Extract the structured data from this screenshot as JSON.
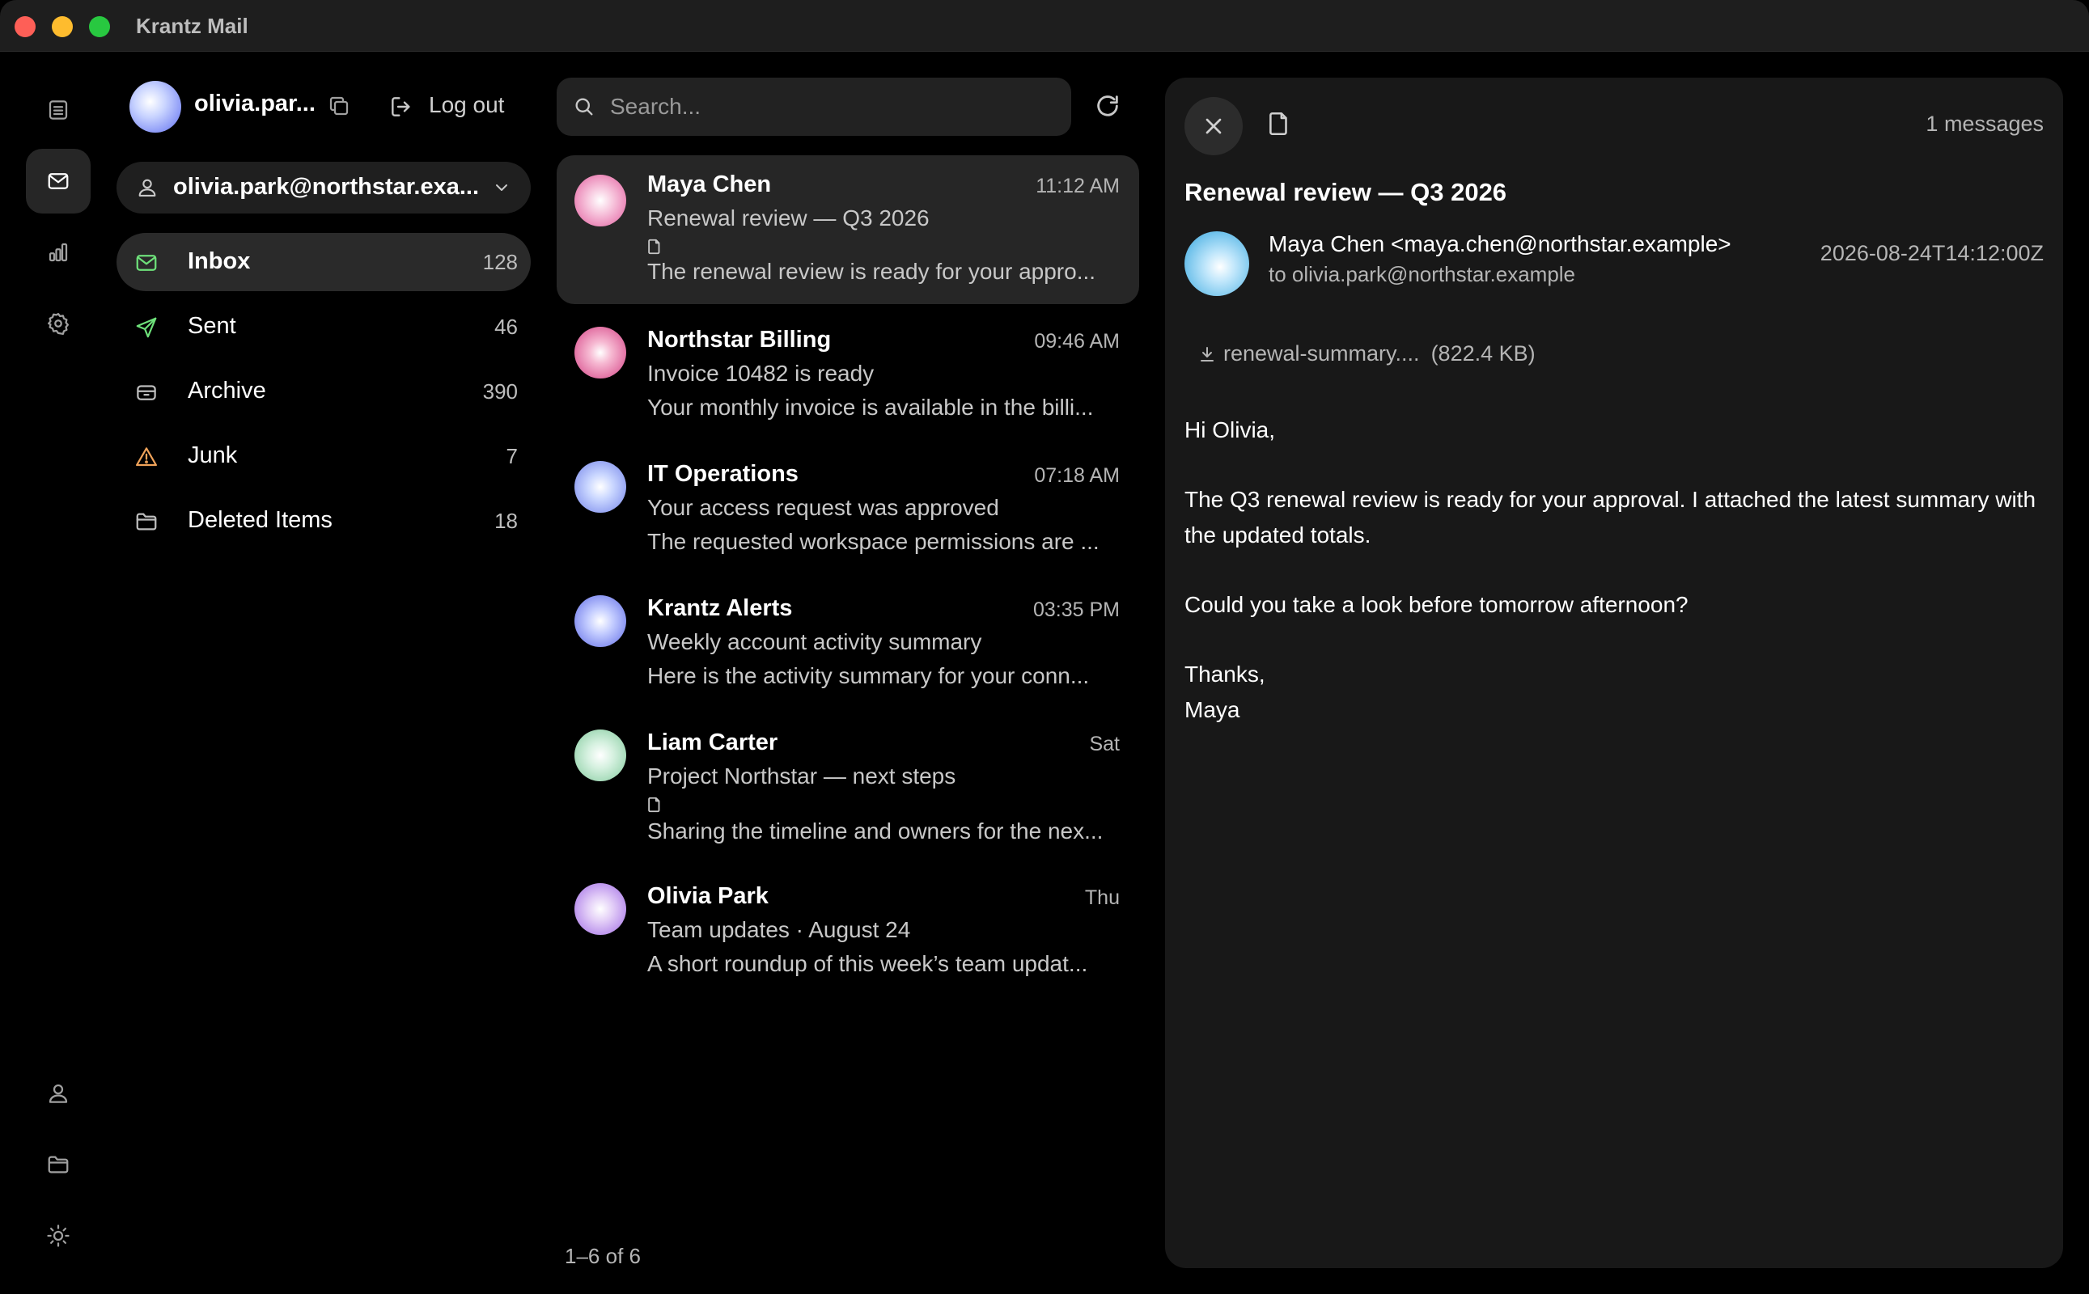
{
  "window": {
    "title": "Krantz Mail"
  },
  "account": {
    "display_name": "olivia.par...",
    "logout_label": "Log out",
    "selected_email": "olivia.park@northstar.exa..."
  },
  "folders": [
    {
      "label": "Inbox",
      "count": "128",
      "icon": "mail-icon",
      "color": "#6ee17a"
    },
    {
      "label": "Sent",
      "count": "46",
      "icon": "send-icon",
      "color": "#6ee17a"
    },
    {
      "label": "Archive",
      "count": "390",
      "icon": "archive-icon",
      "color": "#bdbdbd"
    },
    {
      "label": "Junk",
      "count": "7",
      "icon": "warning-icon",
      "color": "#f0a35a"
    },
    {
      "label": "Deleted Items",
      "count": "18",
      "icon": "folder-icon",
      "color": "#bdbdbd"
    }
  ],
  "search": {
    "placeholder": "Search..."
  },
  "messages": [
    {
      "sender": "Maya Chen",
      "time": "11:12 AM",
      "subject": "Renewal review — Q3 2026",
      "preview": "The renewal review is ready for your appro...",
      "has_attachment": true
    },
    {
      "sender": "Northstar Billing",
      "time": "09:46 AM",
      "subject": "Invoice 10482 is ready",
      "preview": "Your monthly invoice is available in the billi...",
      "has_attachment": false
    },
    {
      "sender": "IT Operations",
      "time": "07:18 AM",
      "subject": "Your access request was approved",
      "preview": "The requested workspace permissions are ...",
      "has_attachment": false
    },
    {
      "sender": "Krantz Alerts",
      "time": "03:35 PM",
      "subject": "Weekly account activity summary",
      "preview": "Here is the activity summary for your conn...",
      "has_attachment": false
    },
    {
      "sender": "Liam Carter",
      "time": "Sat",
      "subject": "Project Northstar — next steps",
      "preview": "Sharing the timeline and owners for the nex...",
      "has_attachment": true
    },
    {
      "sender": "Olivia Park",
      "time": "Thu",
      "subject": "Team updates · August 24",
      "preview": "A short roundup of this week’s team updat...",
      "has_attachment": false
    }
  ],
  "pagination": "1–6 of 6",
  "reader": {
    "message_count": "1 messages",
    "subject": "Renewal review — Q3 2026",
    "from": "Maya Chen <maya.chen@northstar.example>",
    "to": "to olivia.park@northstar.example",
    "date": "2026-08-24T14:12:00Z",
    "attachment_name": "renewal-summary....",
    "attachment_size": "(822.4 KB)",
    "body": {
      "greeting": "Hi Olivia,",
      "paragraph1": "The Q3 renewal review is ready for your approval. I attached the latest summary with the updated totals.",
      "paragraph2": "Could you take a look before tomorrow afternoon?",
      "signoff": "Thanks,",
      "signature": "Maya"
    }
  }
}
